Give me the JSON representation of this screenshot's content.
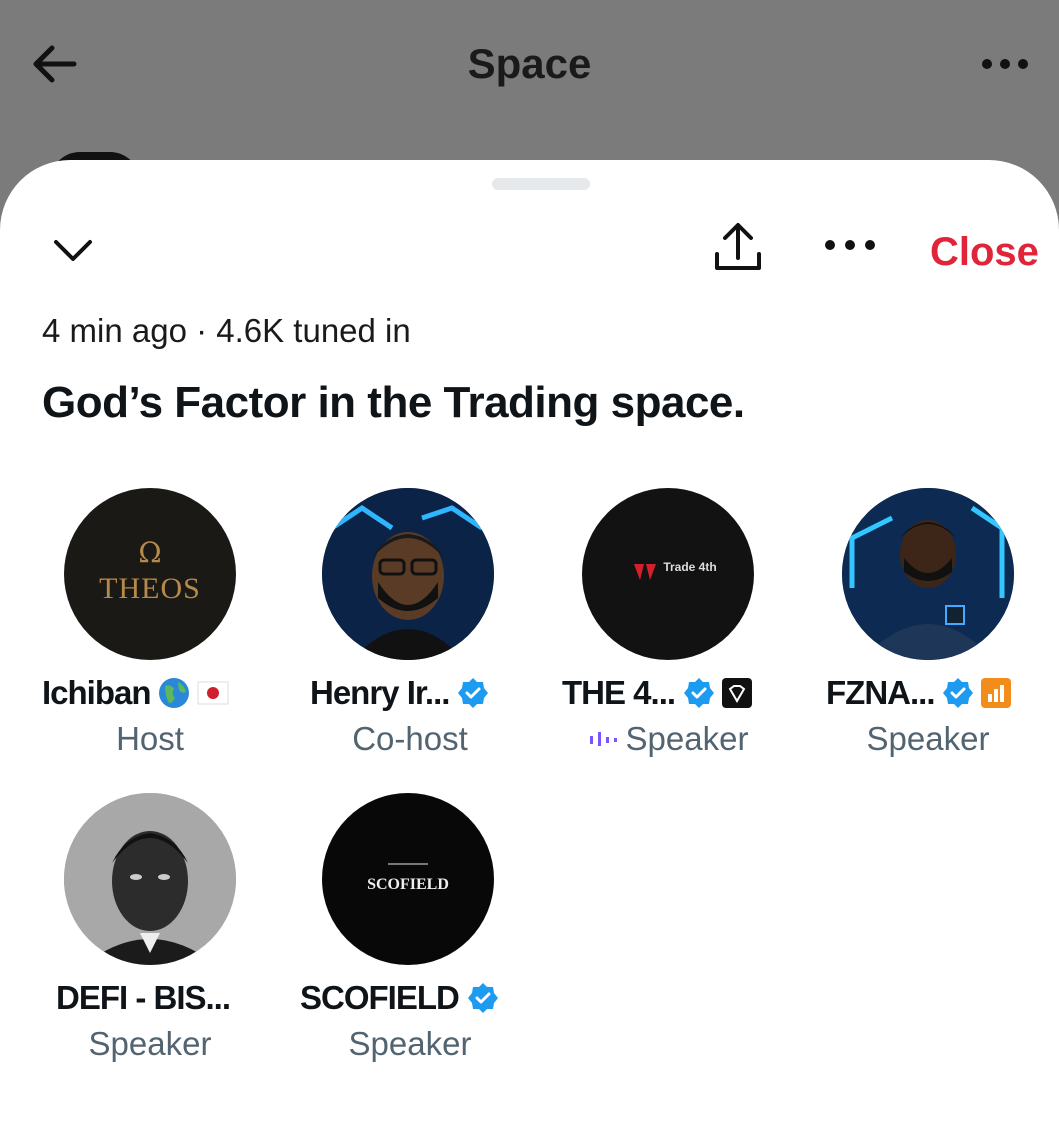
{
  "header": {
    "title": "Space",
    "back_icon": "back-arrow-icon",
    "more_icon": "more-horizontal-icon"
  },
  "sheet": {
    "close_label": "Close",
    "meta": "4 min ago · 4.6K tuned in",
    "title": "God’s Factor in the Trading space."
  },
  "participants": [
    {
      "name": "Ichiban",
      "role": "Host",
      "avatar_text": "THEOS",
      "avatar_symbol": "Ω",
      "emoji": [
        "globe-icon",
        "japan-flag-icon"
      ]
    },
    {
      "name": "Henry Ir...",
      "role": "Co-host",
      "verified": true
    },
    {
      "name": "THE 4...",
      "role": "Speaker",
      "verified": true,
      "avatar_text": "Trade 4th",
      "speaking": true
    },
    {
      "name": "FZNA...",
      "role": "Speaker",
      "verified": true
    },
    {
      "name": "DEFI - BIS...",
      "role": "Speaker"
    },
    {
      "name": "SCOFIELD",
      "role": "Speaker",
      "verified": true,
      "avatar_text": "SCOFIELD"
    }
  ],
  "colors": {
    "accent_red": "#e0243a",
    "verified_blue": "#1d9bf0",
    "secondary_text": "#536471",
    "speaking_purple": "#7856ff"
  }
}
